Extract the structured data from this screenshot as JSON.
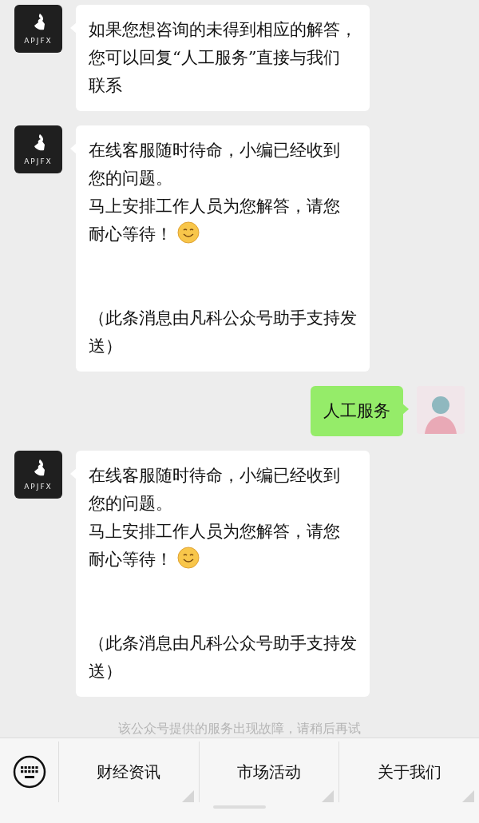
{
  "messages": [
    {
      "outgoing": false,
      "avatar": {
        "kind": "logo",
        "label": "APJFX"
      },
      "lines": [
        {
          "text": "如果您想咨询的未得到相应的解答，"
        },
        {
          "text": "您可以回复“人工服务”直接与我们"
        },
        {
          "text": "联系"
        }
      ]
    },
    {
      "outgoing": false,
      "avatar": {
        "kind": "logo",
        "label": "APJFX"
      },
      "lines": [
        {
          "text": "在线客服随时待命，小编已经收到"
        },
        {
          "text": "您的问题。"
        },
        {
          "text": "马上安排工作人员为您解答，请您"
        },
        {
          "text": "耐心等待！",
          "emoji": true
        }
      ],
      "footnote": [
        "（此条消息由凡科公众号助手支持发",
        "送）"
      ]
    },
    {
      "outgoing": true,
      "avatar": {
        "kind": "user"
      },
      "lines": [
        {
          "text": "人工服务"
        }
      ]
    },
    {
      "outgoing": false,
      "avatar": {
        "kind": "logo",
        "label": "APJFX"
      },
      "lines": [
        {
          "text": "在线客服随时待命，小编已经收到"
        },
        {
          "text": "您的问题。"
        },
        {
          "text": "马上安排工作人员为您解答，请您"
        },
        {
          "text": "耐心等待！",
          "emoji": true
        }
      ],
      "footnote": [
        "（此条消息由凡科公众号助手支持发",
        "送）"
      ]
    }
  ],
  "system_notice": "该公众号提供的服务出现故障，请稍后再试",
  "menu": [
    "财经资讯",
    "市场活动",
    "关于我们"
  ]
}
